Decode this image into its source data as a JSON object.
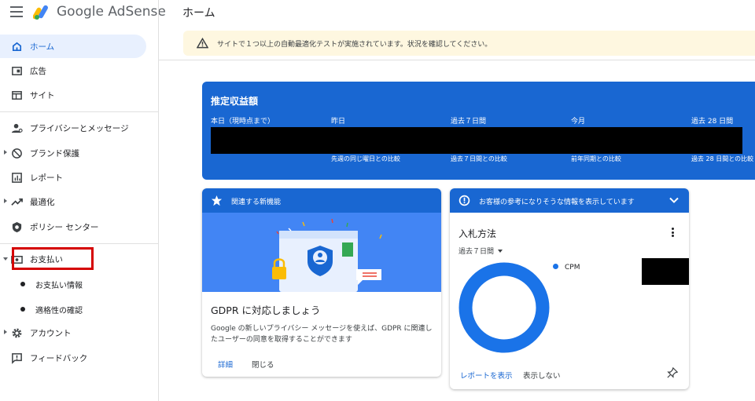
{
  "header": {
    "brand": "Google AdSense",
    "page_title": "ホーム"
  },
  "sidebar": {
    "items": [
      {
        "label": "ホーム",
        "icon": "home-icon"
      },
      {
        "label": "広告",
        "icon": "ads-icon"
      },
      {
        "label": "サイト",
        "icon": "sites-icon"
      },
      {
        "label": "プライバシーとメッセージ",
        "icon": "privacy-icon"
      },
      {
        "label": "ブランド保護",
        "icon": "block-icon"
      },
      {
        "label": "レポート",
        "icon": "report-icon"
      },
      {
        "label": "最適化",
        "icon": "trending-icon"
      },
      {
        "label": "ポリシー センター",
        "icon": "policy-icon"
      },
      {
        "label": "お支払い",
        "icon": "payments-icon"
      },
      {
        "label": "アカウント",
        "icon": "gear-icon"
      },
      {
        "label": "フィードバック",
        "icon": "feedback-icon"
      }
    ],
    "payments_sub": [
      {
        "label": "お支払い情報"
      },
      {
        "label": "適格性の確認"
      }
    ]
  },
  "alert": {
    "text": "サイトで１つ以上の自動最適化テストが実施されています。状況を確認してください。"
  },
  "earnings": {
    "title": "推定収益額",
    "columns": [
      "本日（現時点まで）",
      "昨日",
      "過去７日間",
      "今月",
      "過去 28 日間"
    ],
    "comparisons": [
      "先週の同じ曜日との比較",
      "過去７日間との比較",
      "前年同期との比較",
      "過去 28 日間との比較"
    ]
  },
  "card_new": {
    "header": "関連する新機能",
    "title": "GDPR に対応しましょう",
    "body": "Google の新しいプライバシー メッセージを使えば、GDPR に関連したユーザーの同意を取得することができます",
    "link_details": "詳細",
    "link_close": "閉じる"
  },
  "card_info": {
    "header": "お客様の参考になりそうな情報を表示しています",
    "title": "入札方法",
    "period": "過去７日間",
    "legend": "CPM",
    "view_report": "レポートを表示",
    "hide": "表示しない"
  },
  "colors": {
    "accent": "#1967d2",
    "alert_bg": "#fef7e0",
    "highlight": "#d50000",
    "active_bg": "#e8f0fe"
  }
}
